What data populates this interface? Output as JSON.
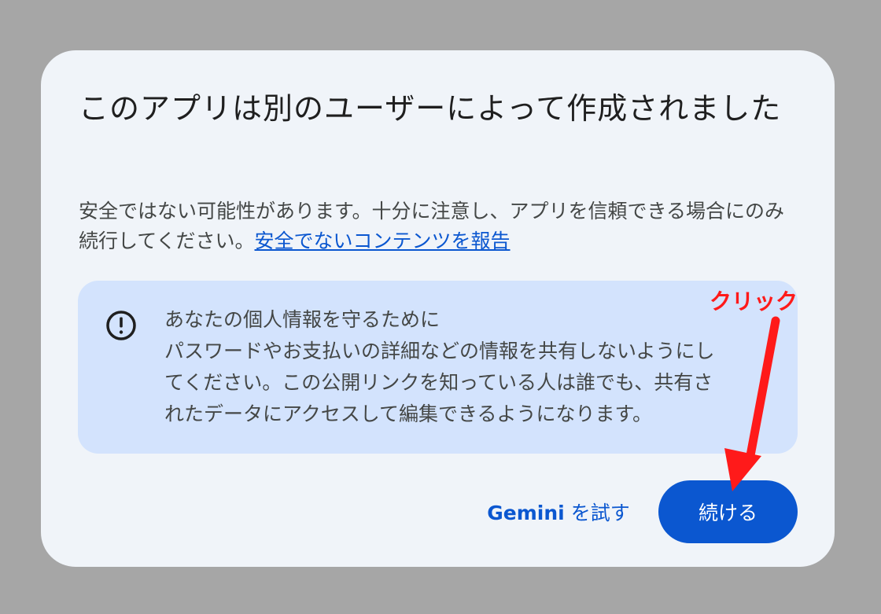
{
  "dialog": {
    "title": "このアプリは別のユーザーによって作成されました",
    "body_text": "安全ではない可能性があります。十分に注意し、アプリを信頼できる場合にのみ続行してください。",
    "report_link": "安全でないコンテンツを報告",
    "info_box": {
      "icon": "alert-circle-icon",
      "lines": [
        "あなたの個人情報を守るために",
        "パスワードやお支払いの詳細などの情報を共有しないようにし",
        "てください。この公開リンクを知っている人は誰でも、共有さ",
        "れたデータにアクセスして編集できるようになります。"
      ]
    },
    "buttons": {
      "try_gemini_brand": "Gemini",
      "try_gemini_rest": " を試す",
      "continue": "続ける"
    }
  },
  "annotation": {
    "label": "クリック",
    "color": "#ff1a1a"
  },
  "colors": {
    "backdrop": "#a6a6a6",
    "dialog_bg": "#f0f4f9",
    "info_bg": "#d3e3fd",
    "primary": "#0b57d0",
    "text": "#1f1f1f"
  }
}
